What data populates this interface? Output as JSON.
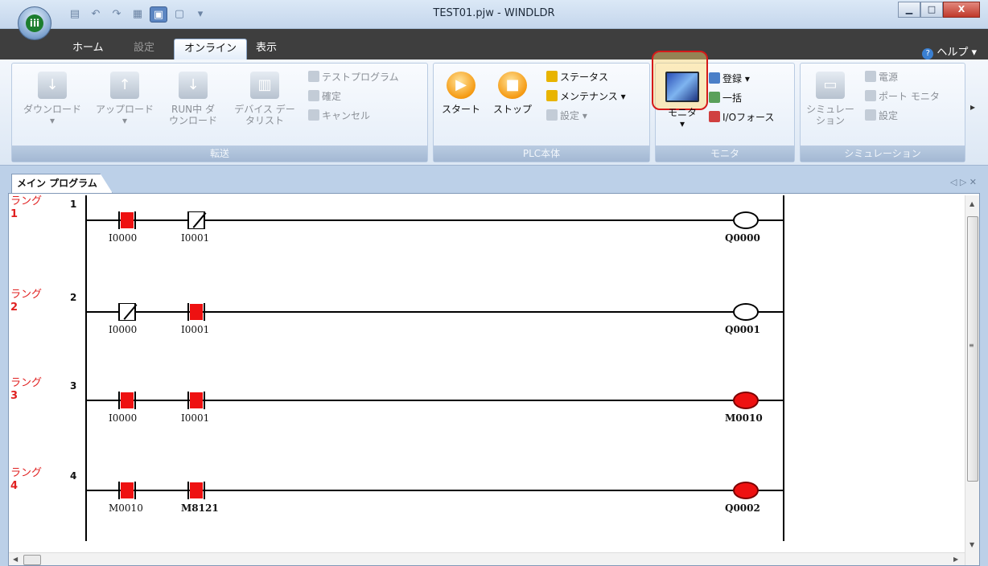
{
  "window": {
    "title": "TEST01.pjw - WINDLDR",
    "orb_label": "iii",
    "minimize": "▁",
    "maximize": "□",
    "close": "X"
  },
  "tabs": [
    {
      "label": "ホーム"
    },
    {
      "label": "設定"
    },
    {
      "label": "オンライン"
    },
    {
      "label": "表示"
    }
  ],
  "help": {
    "label": "ヘルプ ▾",
    "icon": "?"
  },
  "ribbon": {
    "transfer": {
      "label": "転送",
      "download": "ダウンロード",
      "download_arrow": "▾",
      "upload": "アップロード",
      "upload_arrow": "▾",
      "run_download_1": "RUN中 ダ",
      "run_download_2": "ウンロード",
      "device_list_1": "デバイス デー",
      "device_list_2": "タリスト",
      "test_program": "テストプログラム",
      "confirm": "確定",
      "cancel": "キャンセル"
    },
    "plc": {
      "label": "PLC本体",
      "start": "スタート",
      "stop": "ストップ",
      "status": "ステータス",
      "maintenance": "メンテナンス ▾",
      "settings": "設定 ▾"
    },
    "monitor": {
      "label": "モニタ",
      "monitor_btn": "モニタ",
      "monitor_arrow": "▾",
      "register": "登録 ▾",
      "batch": "一括",
      "io_force": "I/Oフォース"
    },
    "simulation": {
      "label": "シミュレーション",
      "simulation_1": "シミュレー",
      "simulation_2": "ション",
      "power": "電源",
      "port_monitor": "ポート モニタ",
      "settings": "設定"
    }
  },
  "document": {
    "tab_label": "メイン プログラム",
    "nav": "◁ ▷ ✕"
  },
  "rungs": [
    {
      "label": "ラング",
      "num": "1",
      "index": "1",
      "c1": "I0000",
      "c2": "I0001",
      "coil": "Q0000"
    },
    {
      "label": "ラング",
      "num": "2",
      "index": "2",
      "c1": "I0000",
      "c2": "I0001",
      "coil": "Q0001"
    },
    {
      "label": "ラング",
      "num": "3",
      "index": "3",
      "c1": "I0000",
      "c2": "I0001",
      "coil": "M0010"
    },
    {
      "label": "ラング",
      "num": "4",
      "index": "4",
      "c1": "M0010",
      "c2": "M8121",
      "coil": "Q0002"
    }
  ],
  "scroll": {
    "up": "▲",
    "down": "▼",
    "left": "◀",
    "right": "▶",
    "grip": "≡"
  },
  "colors": {
    "contact_on": "#ee1111",
    "coil_on": "#ee1111",
    "rung_label": "#e02020",
    "highlight": "#d51a1a"
  }
}
